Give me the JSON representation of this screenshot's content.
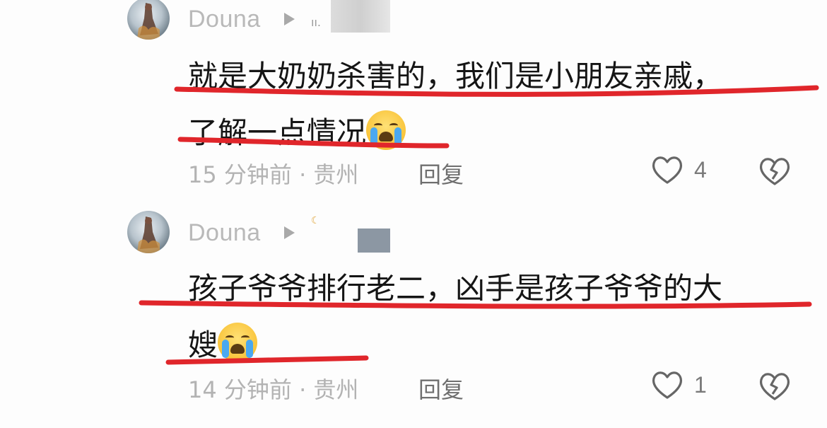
{
  "colors": {
    "underline": "#e0262b",
    "username": "#b9b9b9",
    "meta": "#b3b3b3",
    "text": "#151515"
  },
  "comments": [
    {
      "username": "Douna",
      "line1": "就是大奶奶杀害的，我们是小朋友亲戚，",
      "line2": "了解一点情况",
      "emoji": "loudly-crying-face",
      "meta": "15 分钟前 · 贵州",
      "reply_label": "回复",
      "like_count": "4"
    },
    {
      "username": "Douna",
      "line1": "孩子爷爷排行老二，凶手是孩子爷爷的大",
      "line2": "嫂",
      "emoji": "loudly-crying-face",
      "meta": "14 分钟前 · 贵州",
      "reply_label": "回复",
      "like_count": "1"
    }
  ]
}
